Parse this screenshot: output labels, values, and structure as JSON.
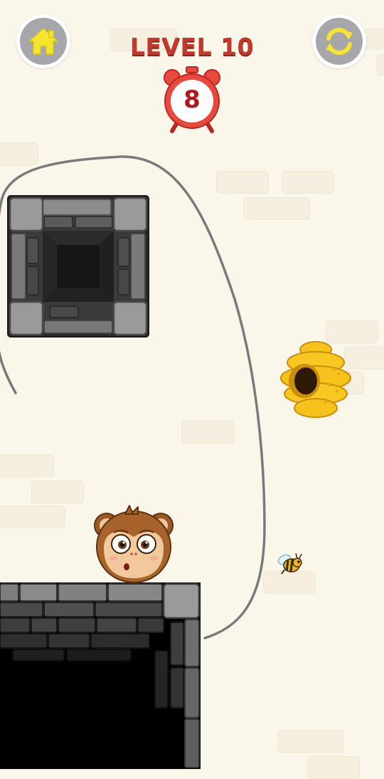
{
  "hud": {
    "level_label": "LEVEL 10",
    "timer_value": "8",
    "home_button_icon": "home-icon",
    "restart_button_icon": "restart-icon"
  },
  "colors": {
    "background": "#fbf6ea",
    "level_text": "#c0392b",
    "button_gray": "#a7a6aa",
    "icon_yellow": "#f5e52f",
    "timer_red": "#e8493e",
    "stone_dark": "#2c2c2c",
    "stone_light": "#8a8a8a",
    "hive_yellow": "#f7c21a",
    "drawn_line": "#7a7a7a"
  },
  "scene": {
    "characters": [
      "monkey",
      "bee"
    ],
    "objects": [
      "stone-frame-block",
      "stone-pit-platform",
      "beehive",
      "drawn-line"
    ]
  }
}
